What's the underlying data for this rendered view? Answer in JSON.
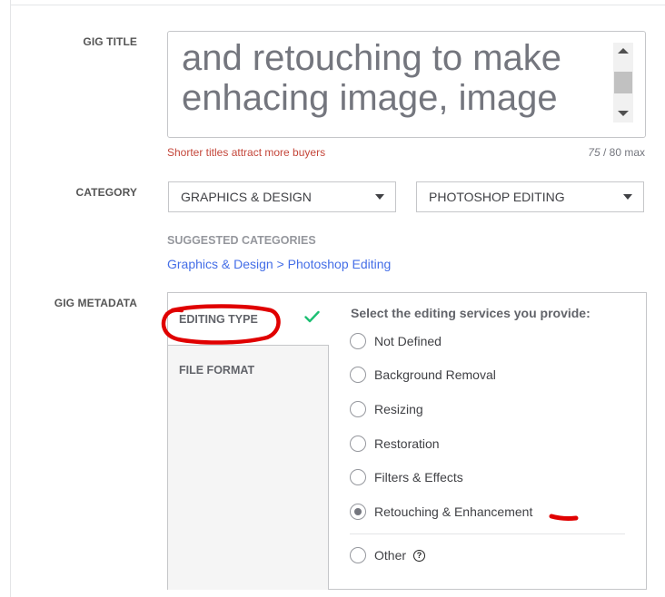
{
  "gig_title": {
    "label": "GIG TITLE",
    "value": "and retouching to make\nenhacing image, image",
    "hint": "Shorter titles attract more buyers",
    "count_current": "75",
    "count_suffix": " / 80 max"
  },
  "category": {
    "label": "CATEGORY",
    "primary": "GRAPHICS & DESIGN",
    "secondary": "PHOTOSHOP EDITING"
  },
  "suggested": {
    "heading": "SUGGESTED CATEGORIES",
    "link": "Graphics & Design > Photoshop Editing"
  },
  "metadata": {
    "label": "GIG METADATA",
    "tabs": [
      {
        "label": "EDITING TYPE",
        "active": true,
        "completed": true
      },
      {
        "label": "FILE FORMAT",
        "active": false,
        "completed": false
      }
    ],
    "question": "Select the editing services you provide:",
    "options": [
      {
        "label": "Not Defined",
        "selected": false
      },
      {
        "label": "Background Removal",
        "selected": false
      },
      {
        "label": "Resizing",
        "selected": false
      },
      {
        "label": "Restoration",
        "selected": false
      },
      {
        "label": "Filters & Effects",
        "selected": false
      },
      {
        "label": "Retouching & Enhancement",
        "selected": true
      },
      {
        "label": "Other",
        "selected": false
      }
    ]
  },
  "colors": {
    "hint_red": "#c4463a",
    "link_blue": "#446ee7",
    "check_green": "#1dbf73",
    "annotation_red": "#e00000"
  }
}
